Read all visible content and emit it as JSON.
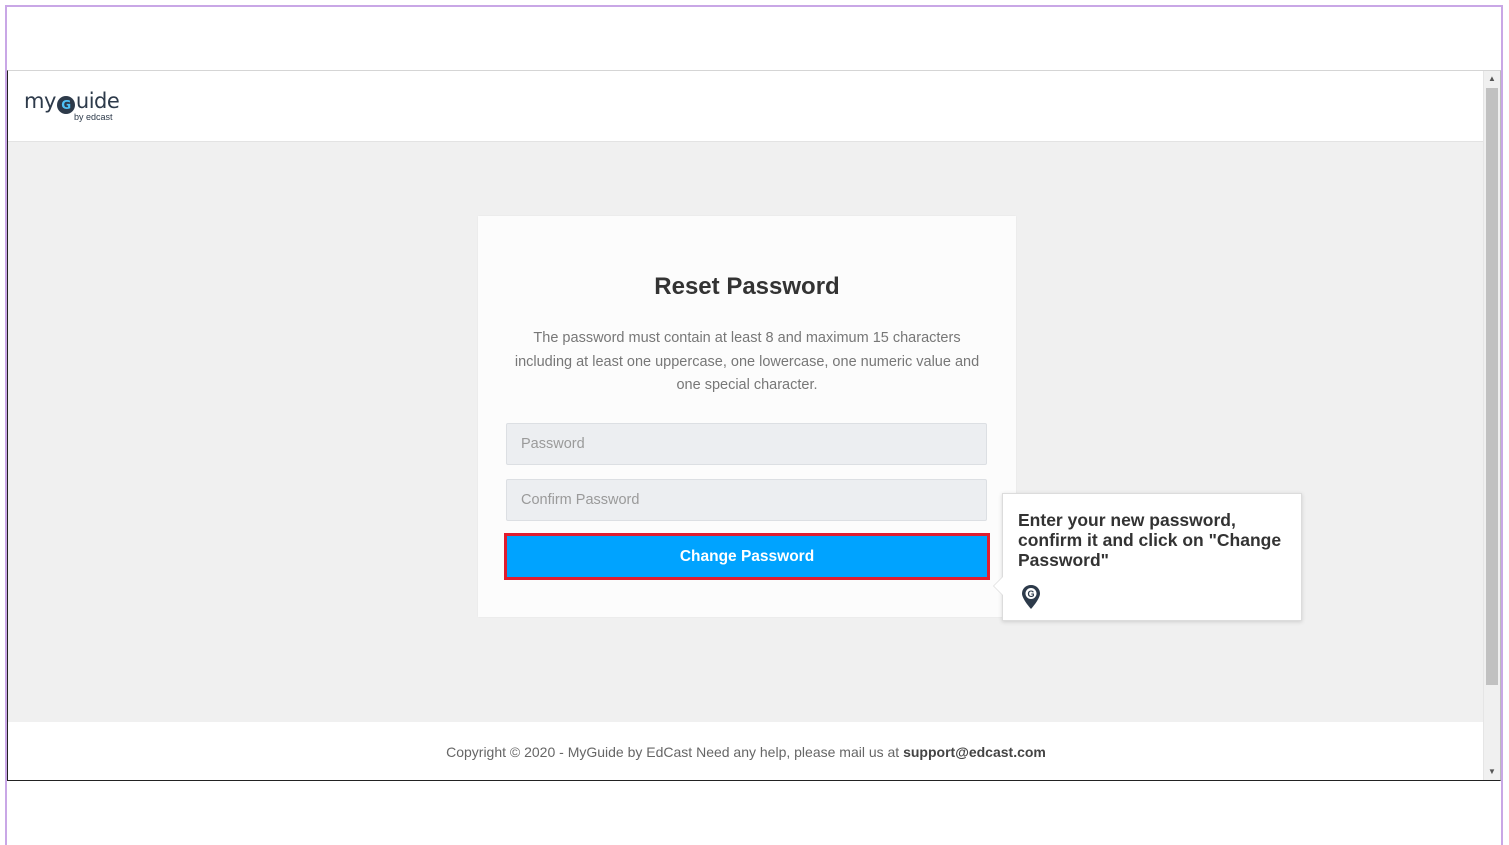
{
  "header": {
    "logo_main_left": "my",
    "logo_pin": "G",
    "logo_main_right": "uide",
    "logo_sub": "by edcast"
  },
  "card": {
    "title": "Reset Password",
    "description": "The password must contain at least 8 and maximum 15 characters including at least one uppercase, one lowercase, one numeric value and one special character.",
    "password_placeholder": "Password",
    "password_value": "",
    "confirm_placeholder": "Confirm Password",
    "confirm_value": "",
    "submit_label": "Change Password"
  },
  "tooltip": {
    "text": "Enter your new password, confirm it and click on \"Change Password\"",
    "icon": "myguide-pin-icon"
  },
  "footer": {
    "text": "Copyright © 2020 - MyGuide by EdCast Need any help, please mail us at",
    "email": "support@edcast.com"
  },
  "colors": {
    "button": "#00a3ff",
    "highlight_border": "#e11d2e",
    "background": "#f0f0f0",
    "frame": "#c9a7e6"
  }
}
